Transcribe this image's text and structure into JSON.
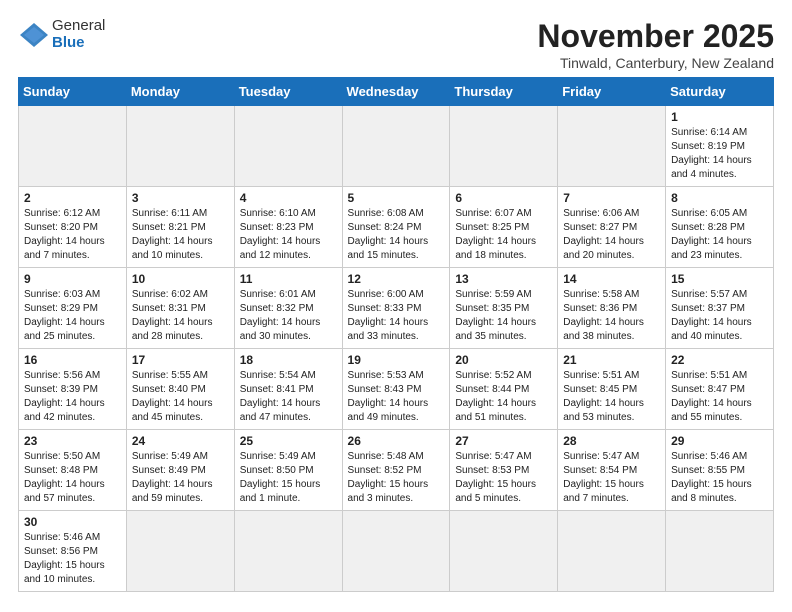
{
  "header": {
    "logo_general": "General",
    "logo_blue": "Blue",
    "month": "November 2025",
    "location": "Tinwald, Canterbury, New Zealand"
  },
  "days_of_week": [
    "Sunday",
    "Monday",
    "Tuesday",
    "Wednesday",
    "Thursday",
    "Friday",
    "Saturday"
  ],
  "weeks": [
    [
      {
        "day": "",
        "info": ""
      },
      {
        "day": "",
        "info": ""
      },
      {
        "day": "",
        "info": ""
      },
      {
        "day": "",
        "info": ""
      },
      {
        "day": "",
        "info": ""
      },
      {
        "day": "",
        "info": ""
      },
      {
        "day": "1",
        "info": "Sunrise: 6:14 AM\nSunset: 8:19 PM\nDaylight: 14 hours and 4 minutes."
      }
    ],
    [
      {
        "day": "2",
        "info": "Sunrise: 6:12 AM\nSunset: 8:20 PM\nDaylight: 14 hours and 7 minutes."
      },
      {
        "day": "3",
        "info": "Sunrise: 6:11 AM\nSunset: 8:21 PM\nDaylight: 14 hours and 10 minutes."
      },
      {
        "day": "4",
        "info": "Sunrise: 6:10 AM\nSunset: 8:23 PM\nDaylight: 14 hours and 12 minutes."
      },
      {
        "day": "5",
        "info": "Sunrise: 6:08 AM\nSunset: 8:24 PM\nDaylight: 14 hours and 15 minutes."
      },
      {
        "day": "6",
        "info": "Sunrise: 6:07 AM\nSunset: 8:25 PM\nDaylight: 14 hours and 18 minutes."
      },
      {
        "day": "7",
        "info": "Sunrise: 6:06 AM\nSunset: 8:27 PM\nDaylight: 14 hours and 20 minutes."
      },
      {
        "day": "8",
        "info": "Sunrise: 6:05 AM\nSunset: 8:28 PM\nDaylight: 14 hours and 23 minutes."
      }
    ],
    [
      {
        "day": "9",
        "info": "Sunrise: 6:03 AM\nSunset: 8:29 PM\nDaylight: 14 hours and 25 minutes."
      },
      {
        "day": "10",
        "info": "Sunrise: 6:02 AM\nSunset: 8:31 PM\nDaylight: 14 hours and 28 minutes."
      },
      {
        "day": "11",
        "info": "Sunrise: 6:01 AM\nSunset: 8:32 PM\nDaylight: 14 hours and 30 minutes."
      },
      {
        "day": "12",
        "info": "Sunrise: 6:00 AM\nSunset: 8:33 PM\nDaylight: 14 hours and 33 minutes."
      },
      {
        "day": "13",
        "info": "Sunrise: 5:59 AM\nSunset: 8:35 PM\nDaylight: 14 hours and 35 minutes."
      },
      {
        "day": "14",
        "info": "Sunrise: 5:58 AM\nSunset: 8:36 PM\nDaylight: 14 hours and 38 minutes."
      },
      {
        "day": "15",
        "info": "Sunrise: 5:57 AM\nSunset: 8:37 PM\nDaylight: 14 hours and 40 minutes."
      }
    ],
    [
      {
        "day": "16",
        "info": "Sunrise: 5:56 AM\nSunset: 8:39 PM\nDaylight: 14 hours and 42 minutes."
      },
      {
        "day": "17",
        "info": "Sunrise: 5:55 AM\nSunset: 8:40 PM\nDaylight: 14 hours and 45 minutes."
      },
      {
        "day": "18",
        "info": "Sunrise: 5:54 AM\nSunset: 8:41 PM\nDaylight: 14 hours and 47 minutes."
      },
      {
        "day": "19",
        "info": "Sunrise: 5:53 AM\nSunset: 8:43 PM\nDaylight: 14 hours and 49 minutes."
      },
      {
        "day": "20",
        "info": "Sunrise: 5:52 AM\nSunset: 8:44 PM\nDaylight: 14 hours and 51 minutes."
      },
      {
        "day": "21",
        "info": "Sunrise: 5:51 AM\nSunset: 8:45 PM\nDaylight: 14 hours and 53 minutes."
      },
      {
        "day": "22",
        "info": "Sunrise: 5:51 AM\nSunset: 8:47 PM\nDaylight: 14 hours and 55 minutes."
      }
    ],
    [
      {
        "day": "23",
        "info": "Sunrise: 5:50 AM\nSunset: 8:48 PM\nDaylight: 14 hours and 57 minutes."
      },
      {
        "day": "24",
        "info": "Sunrise: 5:49 AM\nSunset: 8:49 PM\nDaylight: 14 hours and 59 minutes."
      },
      {
        "day": "25",
        "info": "Sunrise: 5:49 AM\nSunset: 8:50 PM\nDaylight: 15 hours and 1 minute."
      },
      {
        "day": "26",
        "info": "Sunrise: 5:48 AM\nSunset: 8:52 PM\nDaylight: 15 hours and 3 minutes."
      },
      {
        "day": "27",
        "info": "Sunrise: 5:47 AM\nSunset: 8:53 PM\nDaylight: 15 hours and 5 minutes."
      },
      {
        "day": "28",
        "info": "Sunrise: 5:47 AM\nSunset: 8:54 PM\nDaylight: 15 hours and 7 minutes."
      },
      {
        "day": "29",
        "info": "Sunrise: 5:46 AM\nSunset: 8:55 PM\nDaylight: 15 hours and 8 minutes."
      }
    ],
    [
      {
        "day": "30",
        "info": "Sunrise: 5:46 AM\nSunset: 8:56 PM\nDaylight: 15 hours and 10 minutes."
      },
      {
        "day": "",
        "info": ""
      },
      {
        "day": "",
        "info": ""
      },
      {
        "day": "",
        "info": ""
      },
      {
        "day": "",
        "info": ""
      },
      {
        "day": "",
        "info": ""
      },
      {
        "day": "",
        "info": ""
      }
    ]
  ]
}
